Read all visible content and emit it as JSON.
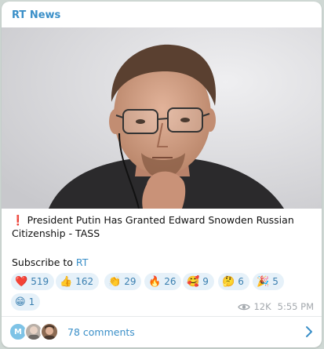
{
  "channel": {
    "name": "RT News"
  },
  "post": {
    "headline_mark": "❗",
    "headline": "President Putin Has Granted Edward Snowden Russian Citizenship - TASS",
    "subscribe_prefix": "Subscribe to ",
    "subscribe_link": "RT"
  },
  "reactions": [
    {
      "emoji": "❤️",
      "icon": "heart-icon",
      "count": "519"
    },
    {
      "emoji": "👍",
      "icon": "thumbs-up-icon",
      "count": "162"
    },
    {
      "emoji": "👏",
      "icon": "clap-icon",
      "count": "29"
    },
    {
      "emoji": "🔥",
      "icon": "fire-icon",
      "count": "26"
    },
    {
      "emoji": "🥰",
      "icon": "smiling-hearts-icon",
      "count": "9"
    },
    {
      "emoji": "🤔",
      "icon": "thinking-face-icon",
      "count": "6"
    },
    {
      "emoji": "🎉",
      "icon": "party-popper-icon",
      "count": "5"
    },
    {
      "emoji": "😁",
      "icon": "grinning-face-icon",
      "count": "1"
    }
  ],
  "meta": {
    "views": "12K",
    "time": "5:55 PM"
  },
  "comments": {
    "avatar_initial": "M",
    "label": "78 comments"
  },
  "colors": {
    "accent": "#3a8fc8",
    "pill_bg": "#e6f1f9",
    "alert": "#e0262f"
  }
}
